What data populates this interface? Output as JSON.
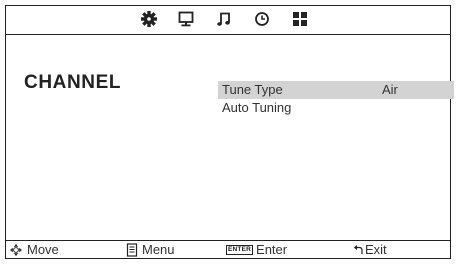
{
  "top_tabs": [
    {
      "icon": "picture-settings-icon",
      "active": true
    },
    {
      "icon": "monitor-icon",
      "active": false
    },
    {
      "icon": "music-note-icon",
      "active": false
    },
    {
      "icon": "clock-icon",
      "active": false
    },
    {
      "icon": "grid-icon",
      "active": false
    }
  ],
  "page_title": "CHANNEL",
  "menu": {
    "items": [
      {
        "label": "Tune Type",
        "value": "Air",
        "selected": true
      },
      {
        "label": "Auto Tuning",
        "value": "",
        "selected": false
      }
    ]
  },
  "footer": {
    "move_label": "Move",
    "menu_label": "Menu",
    "enter_key": "ENTER",
    "enter_label": "Enter",
    "exit_label": "Exit"
  },
  "colors": {
    "selected_row": "#d3d3d3",
    "border": "#222222"
  }
}
